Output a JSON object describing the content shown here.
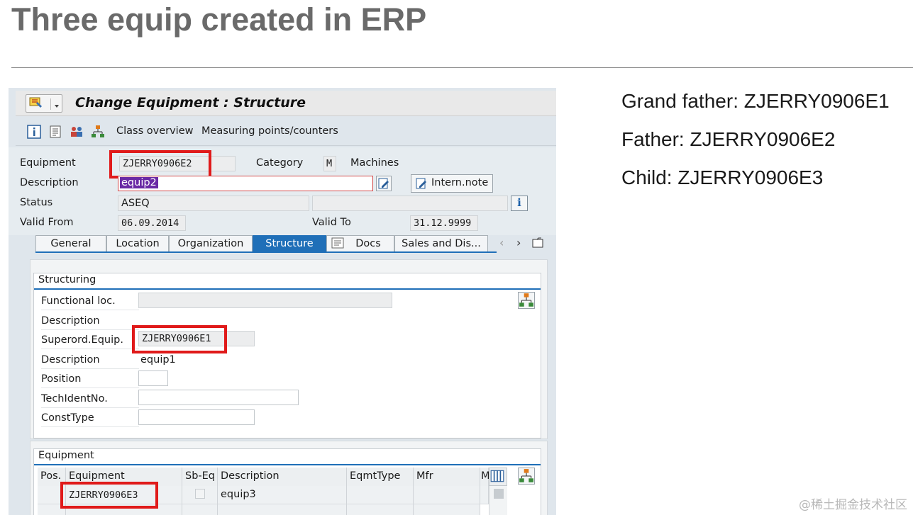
{
  "slide": {
    "title": "Three equip created in ERP",
    "notes": [
      "Grand father: ZJERRY0906E1",
      "Father: ZJERRY0906E2",
      "Child: ZJERRY0906E3"
    ],
    "watermark": "@稀土掘金技术社区"
  },
  "sap": {
    "window_title": "Change Equipment : Structure",
    "toolbar": {
      "class_overview": "Class overview",
      "measuring_points": "Measuring points/counters"
    },
    "header": {
      "equipment_label": "Equipment",
      "equipment_value": "ZJERRY0906E2",
      "category_label": "Category",
      "category_value": "M",
      "category_text": "Machines",
      "description_label": "Description",
      "description_value": "equip2",
      "intern_note_label": "Intern.note",
      "status_label": "Status",
      "status_value": "ASEQ",
      "valid_from_label": "Valid From",
      "valid_from_value": "06.09.2014",
      "valid_to_label": "Valid To",
      "valid_to_value": "31.12.9999"
    },
    "tabs": [
      "General",
      "Location",
      "Organization",
      "Structure",
      "Docs",
      "Sales and Dis..."
    ],
    "active_tab": "Structure",
    "structuring": {
      "title": "Structuring",
      "functional_loc_label": "Functional loc.",
      "functional_loc_value": "",
      "description_label": "Description",
      "superord_label": "Superord.Equip.",
      "superord_value": "ZJERRY0906E1",
      "superord_desc_label": "Description",
      "superord_desc_value": "equip1",
      "position_label": "Position",
      "techident_label": "TechIdentNo.",
      "consttype_label": "ConstType"
    },
    "equipment_grid": {
      "title": "Equipment",
      "columns": [
        "Pos.",
        "Equipment",
        "Sb-Eq",
        "Description",
        "EqmtType",
        "Mfr",
        "M"
      ],
      "rows": [
        {
          "pos": "",
          "equipment": "ZJERRY0906E3",
          "sb_eq": "",
          "description": "equip3",
          "eqmt_type": "",
          "mfr": ""
        }
      ]
    }
  },
  "colors": {
    "highlight_red": "#e01a1a",
    "tab_active": "#1f6fb8",
    "selection": "#6a2aa5"
  }
}
